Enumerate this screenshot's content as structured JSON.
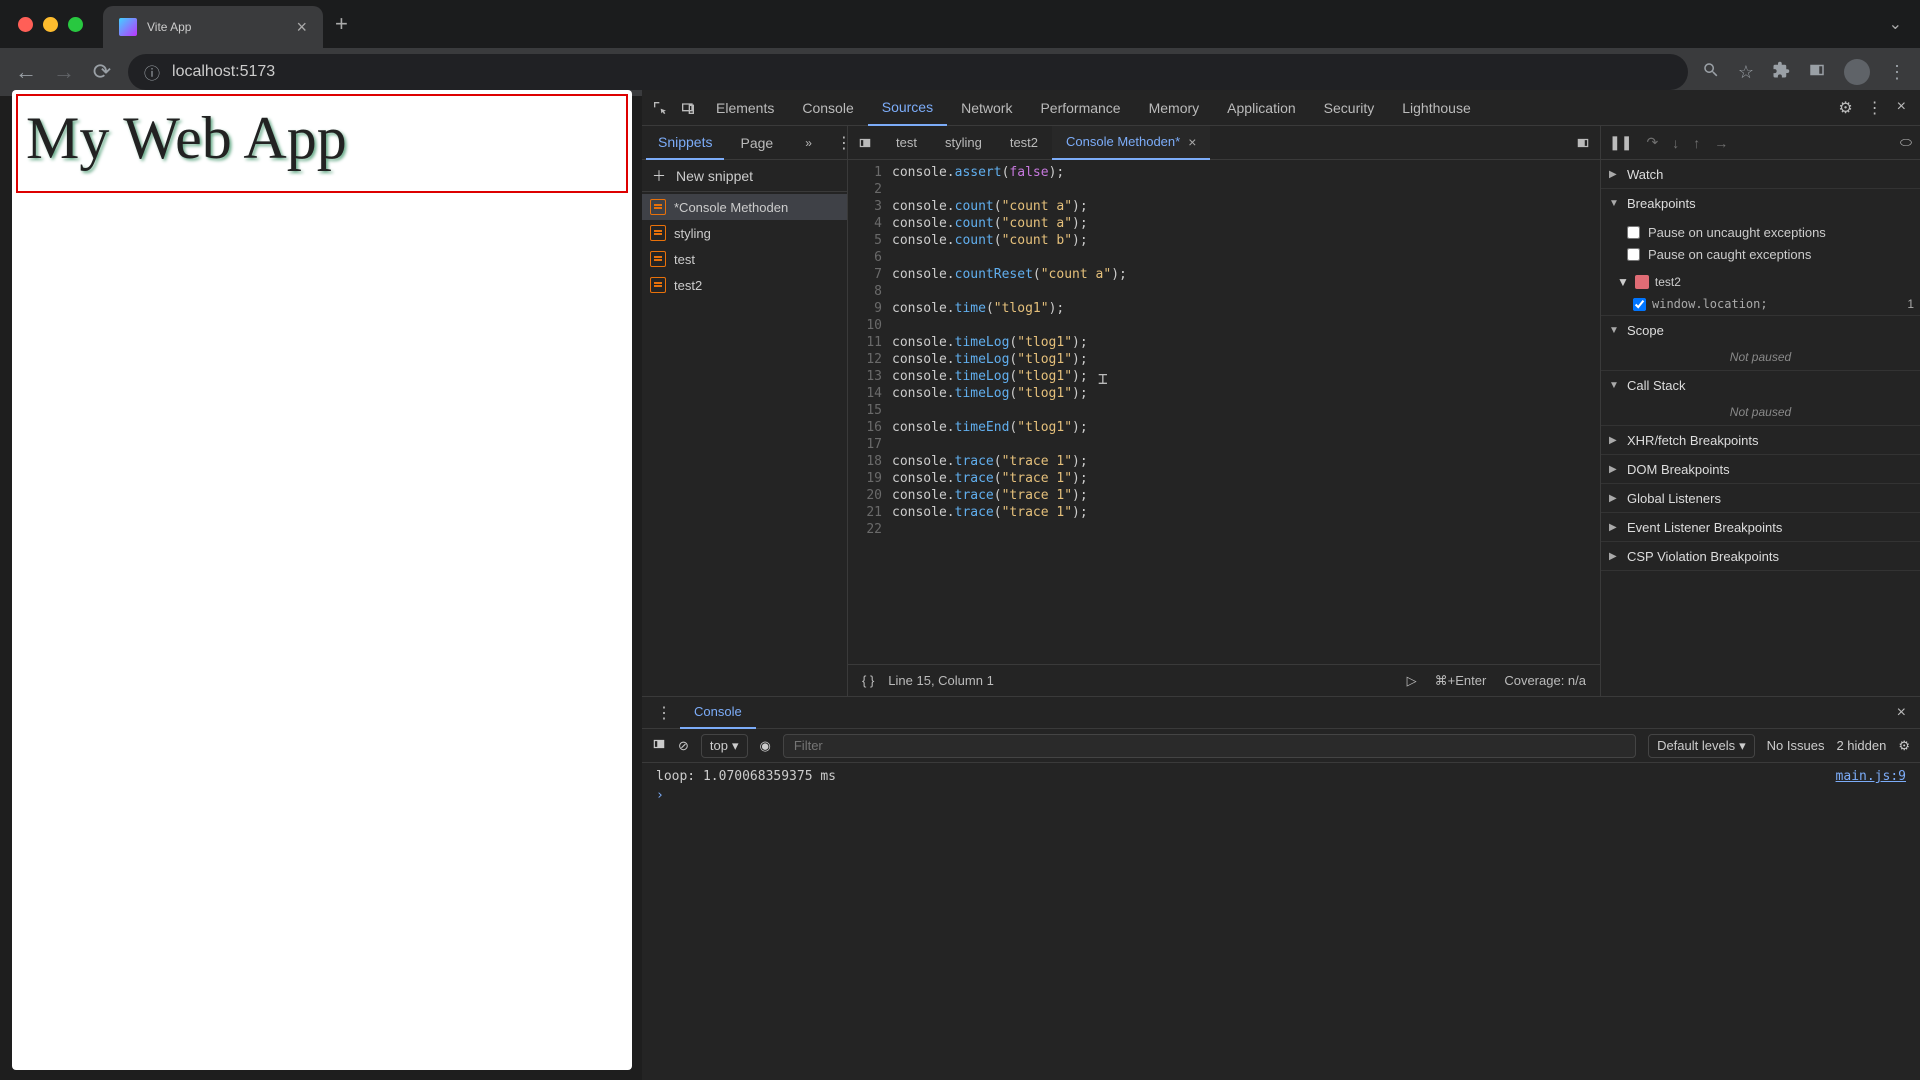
{
  "browser": {
    "tab_title": "Vite App",
    "url": "localhost:5173"
  },
  "page": {
    "heading": "My Web App"
  },
  "devtools": {
    "main_tabs": [
      "Elements",
      "Console",
      "Sources",
      "Network",
      "Performance",
      "Memory",
      "Application",
      "Security",
      "Lighthouse"
    ],
    "active_main_tab": "Sources",
    "sources_nav": {
      "tabs": [
        "Snippets",
        "Page"
      ],
      "active": "Snippets",
      "new_snippet": "New snippet"
    },
    "snippets": [
      "*Console Methoden",
      "styling",
      "test",
      "test2"
    ],
    "editor_tabs": [
      "test",
      "styling",
      "test2",
      "Console Methoden*"
    ],
    "active_editor_tab": "Console Methoden*",
    "code_lines": [
      [
        [
          "",
          "console."
        ],
        [
          "m",
          "assert"
        ],
        [
          "",
          "("
        ],
        [
          "b",
          "false"
        ],
        [
          "",
          ");"
        ]
      ],
      [
        [
          "",
          ""
        ]
      ],
      [
        [
          "",
          "console."
        ],
        [
          "m",
          "count"
        ],
        [
          "",
          "("
        ],
        [
          "s",
          "\"count a\""
        ],
        [
          "",
          ");"
        ]
      ],
      [
        [
          "",
          "console."
        ],
        [
          "m",
          "count"
        ],
        [
          "",
          "("
        ],
        [
          "s",
          "\"count a\""
        ],
        [
          "",
          ");"
        ]
      ],
      [
        [
          "",
          "console."
        ],
        [
          "m",
          "count"
        ],
        [
          "",
          "("
        ],
        [
          "s",
          "\"count b\""
        ],
        [
          "",
          ");"
        ]
      ],
      [
        [
          "",
          ""
        ]
      ],
      [
        [
          "",
          "console."
        ],
        [
          "m",
          "countReset"
        ],
        [
          "",
          "("
        ],
        [
          "s",
          "\"count a\""
        ],
        [
          "",
          ");"
        ]
      ],
      [
        [
          "",
          ""
        ]
      ],
      [
        [
          "",
          "console."
        ],
        [
          "m",
          "time"
        ],
        [
          "",
          "("
        ],
        [
          "s",
          "\"tlog1\""
        ],
        [
          "",
          ");"
        ]
      ],
      [
        [
          "",
          ""
        ]
      ],
      [
        [
          "",
          "console."
        ],
        [
          "m",
          "timeLog"
        ],
        [
          "",
          "("
        ],
        [
          "s",
          "\"tlog1\""
        ],
        [
          "",
          ");"
        ]
      ],
      [
        [
          "",
          "console."
        ],
        [
          "m",
          "timeLog"
        ],
        [
          "",
          "("
        ],
        [
          "s",
          "\"tlog1\""
        ],
        [
          "",
          ");"
        ]
      ],
      [
        [
          "",
          "console."
        ],
        [
          "m",
          "timeLog"
        ],
        [
          "",
          "("
        ],
        [
          "s",
          "\"tlog1\""
        ],
        [
          "",
          ");"
        ]
      ],
      [
        [
          "",
          "console."
        ],
        [
          "m",
          "timeLog"
        ],
        [
          "",
          "("
        ],
        [
          "s",
          "\"tlog1\""
        ],
        [
          "",
          ");"
        ]
      ],
      [
        [
          "",
          ""
        ]
      ],
      [
        [
          "",
          "console."
        ],
        [
          "m",
          "timeEnd"
        ],
        [
          "",
          "("
        ],
        [
          "s",
          "\"tlog1\""
        ],
        [
          "",
          ");"
        ]
      ],
      [
        [
          "",
          ""
        ]
      ],
      [
        [
          "",
          "console."
        ],
        [
          "m",
          "trace"
        ],
        [
          "",
          "("
        ],
        [
          "s",
          "\"trace 1\""
        ],
        [
          "",
          ");"
        ]
      ],
      [
        [
          "",
          "console."
        ],
        [
          "m",
          "trace"
        ],
        [
          "",
          "("
        ],
        [
          "s",
          "\"trace 1\""
        ],
        [
          "",
          ");"
        ]
      ],
      [
        [
          "",
          "console."
        ],
        [
          "m",
          "trace"
        ],
        [
          "",
          "("
        ],
        [
          "s",
          "\"trace 1\""
        ],
        [
          "",
          ");"
        ]
      ],
      [
        [
          "",
          "console."
        ],
        [
          "m",
          "trace"
        ],
        [
          "",
          "("
        ],
        [
          "s",
          "\"trace 1\""
        ],
        [
          "",
          ");"
        ]
      ],
      [
        [
          "",
          ""
        ]
      ]
    ],
    "status": {
      "position": "Line 15, Column 1",
      "shortcut": "⌘+Enter",
      "coverage": "Coverage: n/a"
    },
    "debugger": {
      "sections": {
        "watch": "Watch",
        "breakpoints": "Breakpoints",
        "pause_uncaught": "Pause on uncaught exceptions",
        "pause_caught": "Pause on caught exceptions",
        "scope": "Scope",
        "callstack": "Call Stack",
        "xhr": "XHR/fetch Breakpoints",
        "dom": "DOM Breakpoints",
        "global": "Global Listeners",
        "event": "Event Listener Breakpoints",
        "csp": "CSP Violation Breakpoints",
        "not_paused": "Not paused"
      },
      "bp_file": "test2",
      "bp_code": "window.location;",
      "bp_line": "1"
    },
    "drawer": {
      "tab": "Console",
      "context": "top",
      "filter_placeholder": "Filter",
      "levels": "Default levels",
      "no_issues": "No Issues",
      "hidden": "2 hidden",
      "log_text": "loop: 1.070068359375 ms",
      "log_src": "main.js:9"
    }
  }
}
